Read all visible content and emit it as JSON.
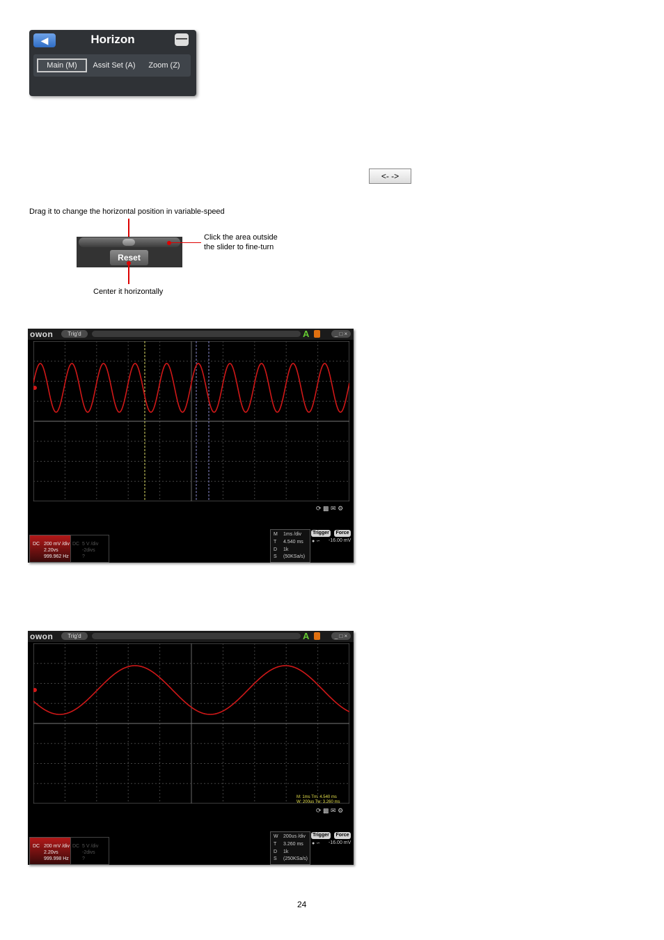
{
  "horizon_panel": {
    "title": "Horizon",
    "tabs": [
      {
        "label": "Main  (M)",
        "active": true
      },
      {
        "label": "Assit Set (A)",
        "active": false
      },
      {
        "label": "Zoom (Z)",
        "active": false
      }
    ]
  },
  "arrow_button": {
    "label": "<-  ->"
  },
  "slider_diagram": {
    "drag_caption": "Drag it to change the horizontal position in variable-speed",
    "click_caption_line1": "Click the area outside",
    "click_caption_line2": "the slider to fine-turn",
    "reset_label": "Reset",
    "center_caption": "Center it horizontally"
  },
  "scope1": {
    "logo": "owon",
    "status": "Trig'd",
    "ch1": {
      "coupling": "DC",
      "volts": "200 mV /div",
      "amp": "2.20vs",
      "freq": "999.962 Hz"
    },
    "ch2": {
      "coupling": "DC",
      "volts": "5 V /div",
      "amp": "-2divs",
      "freq": "?"
    },
    "timebase": {
      "m": "M",
      "m_val": "1ms /div",
      "t": "T",
      "t_val": "4.540 ms",
      "d": "D",
      "d_val": "1k",
      "s": "S",
      "s_val": "(50KSa/s)"
    },
    "trigger_label": "Trigger",
    "force_label": "Force",
    "trigger_level": "-16.00 mV"
  },
  "scope2": {
    "logo": "owon",
    "status": "Trig'd",
    "ch1": {
      "coupling": "DC",
      "volts": "200 mV /div",
      "amp": "2.20vs",
      "freq": "999.998 Hz"
    },
    "ch2": {
      "coupling": "DC",
      "volts": "5 V /div",
      "amp": "-2divs",
      "freq": "?"
    },
    "timebase": {
      "m": "W",
      "m_val": "200us /div",
      "t": "T",
      "t_val": "3.260 ms",
      "d": "D",
      "d_val": "1k",
      "s": "S",
      "s_val": "(250KSa/s)"
    },
    "zoom_info": {
      "line1": "M: 1ms        Tm: 4.540 ms",
      "line2": "W: 200us      Tw: 3.260 ms"
    },
    "trigger_label": "Trigger",
    "force_label": "Force",
    "trigger_level": "-16.00 mV"
  },
  "page_number": "24"
}
